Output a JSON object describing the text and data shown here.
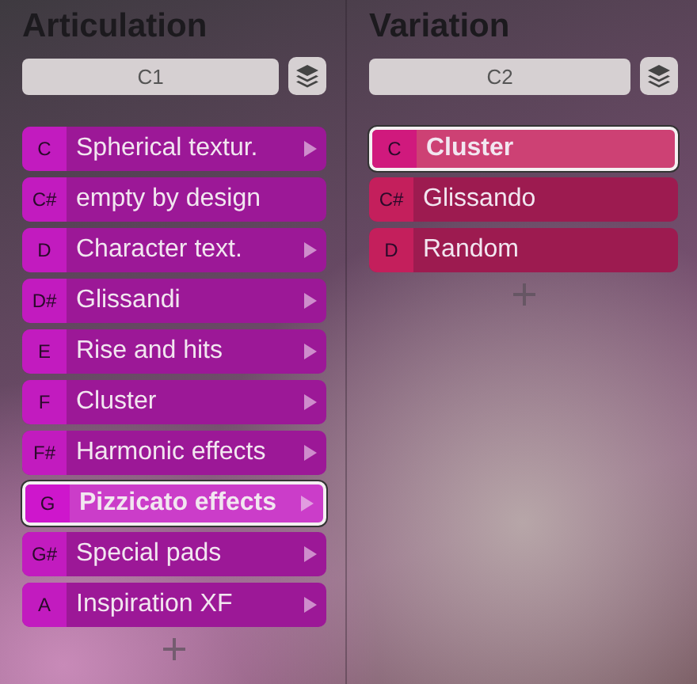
{
  "panels": [
    {
      "title": "Articulation",
      "field": "C1",
      "color": "#c21bbf",
      "items": [
        {
          "note": "C",
          "label": "Spherical textur.",
          "has_submenu": true,
          "selected": false
        },
        {
          "note": "C#",
          "label": "empty by design",
          "has_submenu": false,
          "selected": false
        },
        {
          "note": "D",
          "label": "Character text.",
          "has_submenu": true,
          "selected": false
        },
        {
          "note": "D#",
          "label": "Glissandi",
          "has_submenu": true,
          "selected": false
        },
        {
          "note": "E",
          "label": "Rise and hits",
          "has_submenu": true,
          "selected": false
        },
        {
          "note": "F",
          "label": "Cluster",
          "has_submenu": true,
          "selected": false
        },
        {
          "note": "F#",
          "label": "Harmonic effects",
          "has_submenu": true,
          "selected": false
        },
        {
          "note": "G",
          "label": "Pizzicato effects",
          "has_submenu": true,
          "selected": true
        },
        {
          "note": "G#",
          "label": "Special pads",
          "has_submenu": true,
          "selected": false
        },
        {
          "note": "A",
          "label": "Inspiration XF",
          "has_submenu": true,
          "selected": false
        }
      ]
    },
    {
      "title": "Variation",
      "field": "C2",
      "color": "#c41f5c",
      "items": [
        {
          "note": "C",
          "label": "Cluster",
          "has_submenu": false,
          "selected": true
        },
        {
          "note": "C#",
          "label": "Glissando",
          "has_submenu": false,
          "selected": false
        },
        {
          "note": "D",
          "label": "Random",
          "has_submenu": false,
          "selected": false
        }
      ]
    }
  ]
}
